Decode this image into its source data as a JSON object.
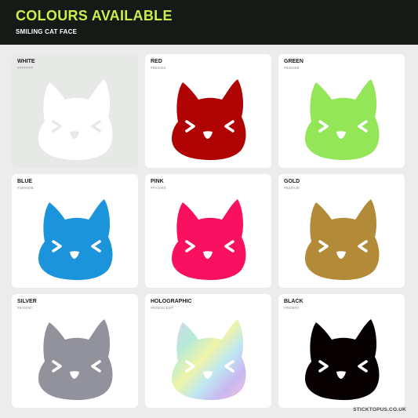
{
  "header": {
    "title": "COLOURS AVAILABLE",
    "subtitle": "SMILING CAT FACE"
  },
  "colours": [
    {
      "name": "WHITE",
      "code": "#FFFFFF",
      "fill": "#FFFFFF",
      "icon": "cat-face-icon"
    },
    {
      "name": "RED",
      "code": "#B00404",
      "fill": "#B00404",
      "icon": "cat-face-icon"
    },
    {
      "name": "GREEN",
      "code": "#93E658",
      "fill": "#93E658",
      "icon": "cat-face-icon"
    },
    {
      "name": "BLUE",
      "code": "#1B94DB",
      "fill": "#1B94DB",
      "icon": "cat-face-icon"
    },
    {
      "name": "PINK",
      "code": "#FA1060",
      "fill": "#FA1060",
      "icon": "cat-face-icon"
    },
    {
      "name": "GOLD",
      "code": "#B38A38",
      "fill": "#B38A38",
      "icon": "cat-face-icon"
    },
    {
      "name": "SILVER",
      "code": "#92929C",
      "fill": "#92929C",
      "icon": "cat-face-icon"
    },
    {
      "name": "HOLOGRAPHIC",
      "code": "IRIDESCENT",
      "fill": "holographic",
      "icon": "cat-face-icon"
    },
    {
      "name": "BLACK",
      "code": "#060000",
      "fill": "#060000",
      "icon": "cat-face-icon"
    }
  ],
  "footer": {
    "website": "STICKTOPUS.CO.UK"
  }
}
